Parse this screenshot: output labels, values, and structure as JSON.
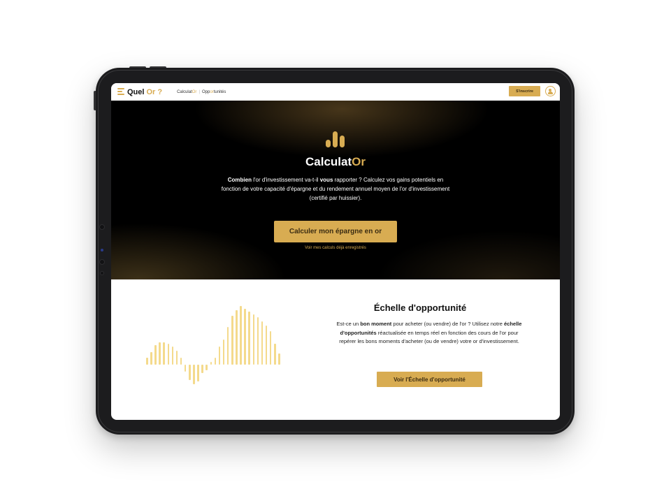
{
  "header": {
    "logo_text": "Quel",
    "logo_accent": "Or ?",
    "nav": [
      {
        "prefix": "Calculat",
        "highlight": "Or"
      },
      {
        "prefix": "Opp",
        "highlight": "or",
        "suffix": "tunités"
      }
    ],
    "signup_label": "S'inscrire",
    "user_icon": "user-icon"
  },
  "hero": {
    "icon": "bar-chart-icon",
    "title_main": "Calculat",
    "title_accent": "Or",
    "description": {
      "lead_bold": "Combien",
      "part1": " l'or d'investissement va-t-il ",
      "bold2": "vous",
      "part2": " rapporter ? Calculez vos gains potentiels en fonction de votre capacité d'épargne et du rendement annuel moyen de l'or d'investissement (certifié par huissier)."
    },
    "cta_label": "Calculer mon épargne en or",
    "secondary_link": "Voir mes calculs déjà enregistrés"
  },
  "opportunity": {
    "title": "Échelle d'opportunité",
    "description": {
      "part1": "Est-ce un ",
      "bold1": "bon moment",
      "part2": " pour acheter (ou vendre) de l'or ? Utilisez notre ",
      "bold2": "échelle d'opportunités",
      "part3": " réactualisée en temps réel en fonction des cours de l'or pour repérer les bons moments d'acheter (ou de vendre) votre or d'investissement."
    },
    "cta_label": "Voir l'Échelle d'opportunité",
    "graphic_icon": "opportunity-wave-graphic"
  },
  "colors": {
    "gold": "#d8ac52",
    "light_gold": "#f4da8c",
    "hero_bg": "#000000",
    "device": "#1c1c1e"
  }
}
